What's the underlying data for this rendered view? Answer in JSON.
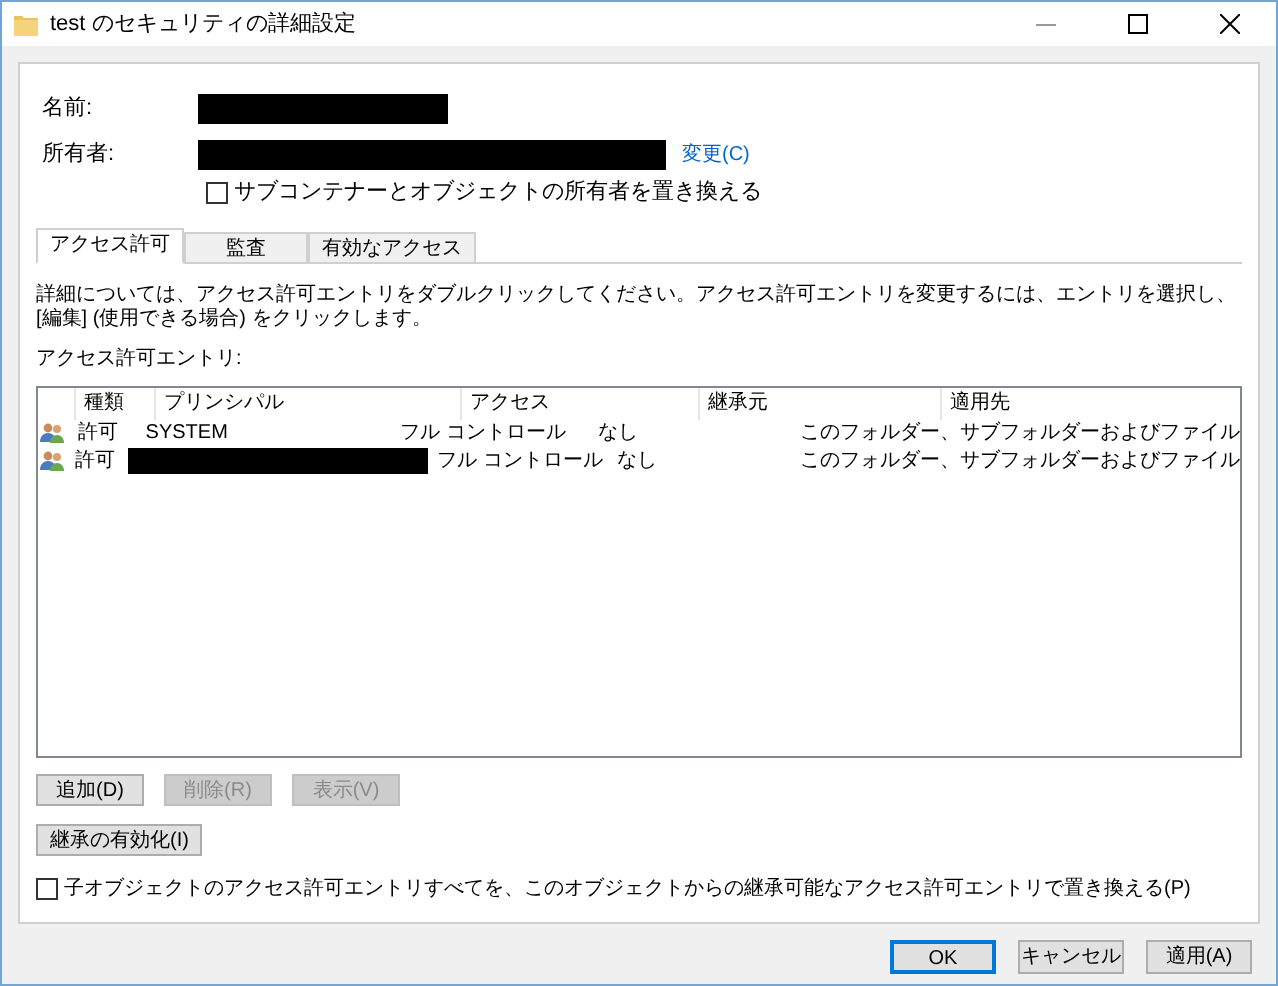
{
  "window": {
    "title": "test のセキュリティの詳細設定"
  },
  "name_field": {
    "label": "名前:",
    "redacted": true
  },
  "owner_field": {
    "label": "所有者:",
    "redacted": true,
    "link": "変更(C)"
  },
  "replace_owner": {
    "label": "サブコンテナーとオブジェクトの所有者を置き換える",
    "checked": false
  },
  "tabs": [
    {
      "label": "アクセス許可",
      "selected": true
    },
    {
      "label": "監査",
      "selected": false
    },
    {
      "label": "有効なアクセス",
      "selected": false
    }
  ],
  "instructions": "詳細については、アクセス許可エントリをダブルクリックしてください。アクセス許可エントリを変更するには、エントリを選択し、[編集] (使用できる場合) をクリックします。",
  "entries_label": "アクセス許可エントリ:",
  "table": {
    "columns": [
      "種類",
      "プリンシパル",
      "アクセス",
      "継承元",
      "適用先"
    ],
    "rows": [
      {
        "type": "許可",
        "principal": "SYSTEM",
        "principal_redacted": false,
        "access": "フル コントロール",
        "inherited_from": "なし",
        "applies_to": "このフォルダー、サブフォルダーおよびファイル"
      },
      {
        "type": "許可",
        "principal": "",
        "principal_redacted": true,
        "access": "フル コントロール",
        "inherited_from": "なし",
        "applies_to": "このフォルダー、サブフォルダーおよびファイル"
      }
    ]
  },
  "entry_buttons": [
    {
      "label": "追加(D)",
      "disabled": false
    },
    {
      "label": "削除(R)",
      "disabled": true
    },
    {
      "label": "表示(V)",
      "disabled": true
    }
  ],
  "inheritance_button": {
    "label": "継承の有効化(I)"
  },
  "replace_child": {
    "label": "子オブジェクトのアクセス許可エントリすべてを、このオブジェクトからの継承可能なアクセス許可エントリで置き換える(P)",
    "checked": false
  },
  "dialog_buttons": [
    {
      "label": "OK",
      "default": true
    },
    {
      "label": "キャンセル",
      "default": false
    },
    {
      "label": "適用(A)",
      "default": false
    }
  ]
}
